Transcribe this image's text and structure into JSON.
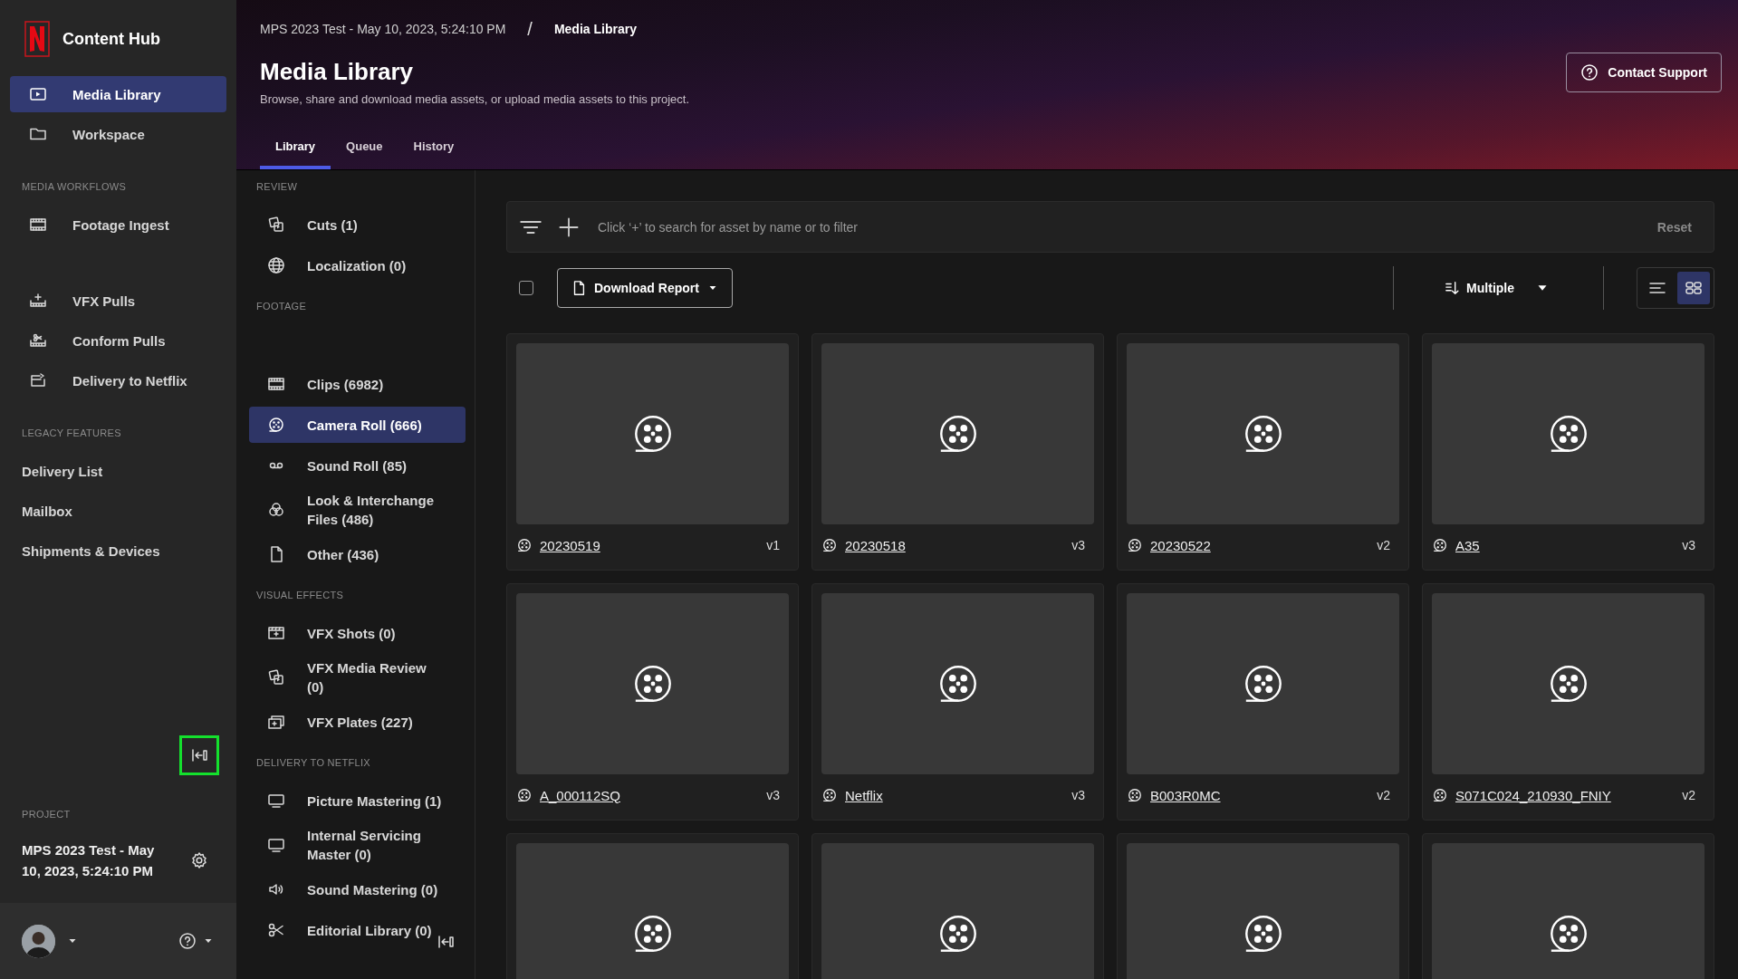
{
  "sidebar": {
    "app_name": "Content Hub",
    "items": [
      {
        "label": "Media Library",
        "selected": true
      },
      {
        "label": "Workspace",
        "selected": false
      }
    ],
    "sections": [
      {
        "heading": "MEDIA WORKFLOWS",
        "kind": "icons",
        "items": [
          {
            "label": "Footage Ingest",
            "selected": false
          },
          {
            "label": "VFX Pulls",
            "selected": false
          },
          {
            "label": "Conform Pulls",
            "selected": false
          },
          {
            "label": "Delivery to Netflix",
            "selected": false
          }
        ]
      },
      {
        "heading": "LEGACY FEATURES",
        "kind": "plain",
        "items": [
          {
            "label": "Delivery List",
            "selected": false
          },
          {
            "label": "Mailbox",
            "selected": false
          },
          {
            "label": "Shipments & Devices",
            "selected": false
          }
        ]
      }
    ],
    "collapse": {
      "highlighted": true
    },
    "project": {
      "heading": "PROJECT",
      "name": "MPS 2023 Test - May 10, 2023, 5:24:10 PM"
    }
  },
  "breadcrumb": {
    "parent": "MPS 2023 Test - May 10, 2023, 5:24:10 PM",
    "separator": "/",
    "current": "Media Library"
  },
  "header": {
    "title": "Media Library",
    "description": "Browse, share and download media assets, or upload media assets to this project.",
    "contact_button": "Contact Support"
  },
  "tabs": [
    {
      "label": "Library",
      "selected": true
    },
    {
      "label": "Queue",
      "selected": false
    },
    {
      "label": "History",
      "selected": false
    }
  ],
  "subnav": {
    "sections": [
      {
        "heading": "REVIEW",
        "items": [
          {
            "label": "Cuts (1)",
            "selected": false
          },
          {
            "label": "Localization (0)",
            "selected": false
          }
        ]
      },
      {
        "heading": "FOOTAGE",
        "items": [
          {
            "label": "Clips (6982)",
            "selected": false
          },
          {
            "label": "Camera Roll (666)",
            "selected": true
          },
          {
            "label": "Sound Roll (85)",
            "selected": false
          },
          {
            "label": "Look & Interchange Files (486)",
            "selected": false
          },
          {
            "label": "Other (436)",
            "selected": false
          }
        ]
      },
      {
        "heading": "VISUAL EFFECTS",
        "items": [
          {
            "label": "VFX Shots (0)",
            "selected": false
          },
          {
            "label": "VFX Media Review (0)",
            "selected": false
          },
          {
            "label": "VFX Plates (227)",
            "selected": false
          }
        ]
      },
      {
        "heading": "DELIVERY TO NETFLIX",
        "items": [
          {
            "label": "Picture Mastering (1)",
            "selected": false
          },
          {
            "label": "Internal Servicing Master (0)",
            "selected": false
          },
          {
            "label": "Sound Mastering (0)",
            "selected": false
          },
          {
            "label": "Editorial Library (0)",
            "selected": false
          }
        ]
      }
    ]
  },
  "filter": {
    "placeholder": "Click ‘+’ to search for asset by name or to filter",
    "reset": "Reset"
  },
  "toolbar": {
    "select_all_checked": false,
    "download": "Download Report",
    "sort": "Multiple",
    "views": [
      {
        "selected": false
      },
      {
        "selected": true
      }
    ]
  },
  "assets": [
    {
      "kind": "asset",
      "name": "20230519",
      "version": "v1"
    },
    {
      "kind": "asset",
      "name": "20230518",
      "version": "v3"
    },
    {
      "kind": "asset",
      "name": "20230522",
      "version": "v2"
    },
    {
      "kind": "asset",
      "name": "A35",
      "version": "v3"
    },
    {
      "kind": "asset",
      "name": "A_000112SQ",
      "version": "v3"
    },
    {
      "kind": "asset",
      "name": "Netflix",
      "version": "v3"
    },
    {
      "kind": "asset",
      "name": "B003R0MC",
      "version": "v2"
    },
    {
      "kind": "asset",
      "name": "S071C024_210930_FNIY",
      "version": "v2"
    },
    {
      "kind": "cut-off"
    },
    {
      "kind": "cut-off"
    },
    {
      "kind": "cut-off"
    },
    {
      "kind": "cut-off"
    }
  ]
}
